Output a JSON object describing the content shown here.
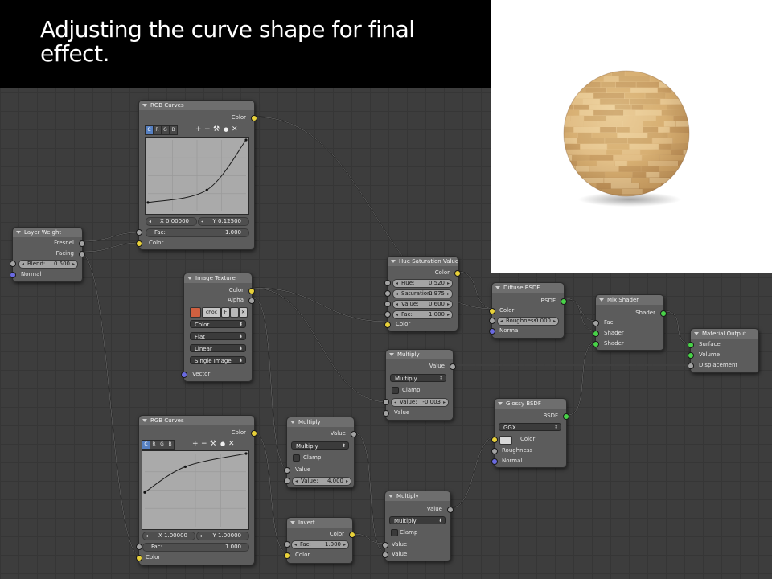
{
  "slide": {
    "title": "Adjusting the curve shape for final effect."
  },
  "nodes": {
    "rgb_curves_top": {
      "title": "RGB Curves",
      "out_color": "Color",
      "channels": [
        "C",
        "R",
        "G",
        "B"
      ],
      "active_channel": "C",
      "tools": {
        "plus": "+",
        "minus": "−",
        "wrench": "⚒",
        "dot": "●",
        "close": "✕"
      },
      "x_field": "X 0.00000",
      "y_field": "Y 0.12500",
      "fac_label": "Fac:",
      "fac_value": "1.000",
      "in_color": "Color",
      "curve_points": [
        [
          0,
          0.125
        ],
        [
          0.6,
          0.3
        ],
        [
          1,
          1
        ]
      ]
    },
    "rgb_curves_bottom": {
      "title": "RGB Curves",
      "out_color": "Color",
      "channels": [
        "C",
        "R",
        "G",
        "B"
      ],
      "active_channel": "C",
      "tools": {
        "plus": "+",
        "minus": "−",
        "wrench": "⚒",
        "dot": "●",
        "close": "✕"
      },
      "x_field": "X 1.00000",
      "y_field": "Y 1.00000",
      "fac_label": "Fac:",
      "fac_value": "1.000",
      "in_color": "Color",
      "curve_points": [
        [
          0,
          0.47
        ],
        [
          0.4,
          0.82
        ],
        [
          1,
          1
        ]
      ]
    },
    "layer_weight": {
      "title": "Layer Weight",
      "out_fresnel": "Fresnel",
      "out_facing": "Facing",
      "blend_label": "Blend:",
      "blend_value": "0.500",
      "in_normal": "Normal"
    },
    "image_texture": {
      "title": "Image Texture",
      "out_color": "Color",
      "out_alpha": "Alpha",
      "image_name": "choc",
      "image_f": "F",
      "color_space": "Color",
      "projection": "Flat",
      "interpolation": "Linear",
      "extension": "Single Image",
      "in_vector": "Vector"
    },
    "hue_sat": {
      "title": "Hue Saturation Value",
      "out_color": "Color",
      "hue_label": "Hue:",
      "hue_value": "0.520",
      "sat_label": "Saturation:",
      "sat_value": "0.975",
      "val_label": "Value:",
      "val_value": "0.600",
      "fac_label": "Fac:",
      "fac_value": "1.000",
      "in_color": "Color"
    },
    "multiply_mid": {
      "title": "Multiply",
      "out_value": "Value",
      "operation": "Multiply",
      "clamp": "Clamp",
      "value_label": "Value:",
      "value_value": "-0.003",
      "in_value": "Value"
    },
    "multiply_left": {
      "title": "Multiply",
      "out_value": "Value",
      "operation": "Multiply",
      "clamp": "Clamp",
      "in_value": "Value",
      "value_label": "Value:",
      "value_value": "4.000"
    },
    "invert": {
      "title": "Invert",
      "out_color": "Color",
      "fac_label": "Fac:",
      "fac_value": "1.000",
      "in_color": "Color"
    },
    "multiply_bottom": {
      "title": "Multiply",
      "out_value": "Value",
      "operation": "Multiply",
      "clamp": "Clamp",
      "in_value1": "Value",
      "in_value2": "Value"
    },
    "diffuse": {
      "title": "Diffuse BSDF",
      "out_bsdf": "BSDF",
      "in_color": "Color",
      "rough_label": "Roughness:",
      "rough_value": "0.000",
      "in_normal": "Normal"
    },
    "glossy": {
      "title": "Glossy BSDF",
      "out_bsdf": "BSDF",
      "distribution": "GGX",
      "in_color": "Color",
      "in_roughness": "Roughness",
      "in_normal": "Normal"
    },
    "mix_shader": {
      "title": "Mix Shader",
      "out_shader": "Shader",
      "in_fac": "Fac",
      "in_shader1": "Shader",
      "in_shader2": "Shader"
    },
    "material_output": {
      "title": "Material Output",
      "in_surface": "Surface",
      "in_volume": "Volume",
      "in_displacement": "Displacement"
    }
  },
  "colors": {
    "socket_color": "#e8d13a",
    "socket_value": "#a3a3a3",
    "socket_vector": "#6a6ae0",
    "socket_shader": "#48d248",
    "wire": "#1e1e1e",
    "wood_light": "#e6c58e",
    "wood_dark": "#b98c52"
  }
}
